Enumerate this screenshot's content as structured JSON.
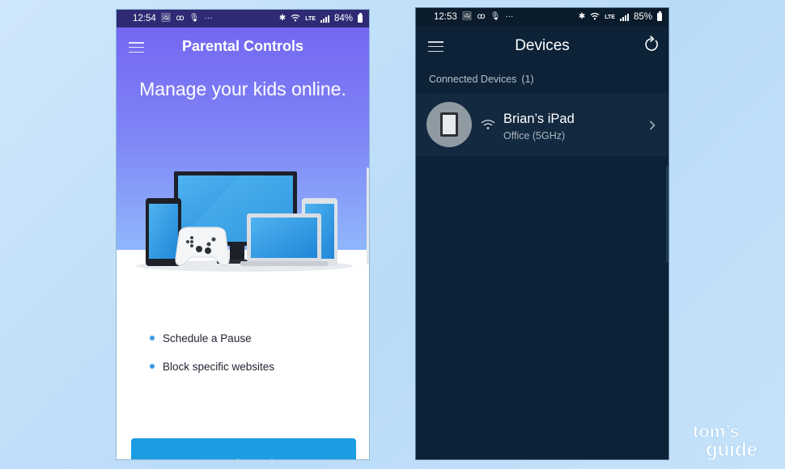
{
  "left_phone": {
    "status": {
      "time": "12:54",
      "icons": [
        "image-icon",
        "voicemail-icon",
        "mic-icon",
        "more-icon"
      ],
      "battery": "84%",
      "network": "LTE"
    },
    "header": {
      "title": "Parental Controls"
    },
    "headline": "Manage your kids online.",
    "features": [
      {
        "label": "Schedule a Pause"
      },
      {
        "label": "Block specific websites"
      }
    ],
    "cta_label": "Control a Device",
    "colors": {
      "hero_top": "#7467f2",
      "hero_bottom": "#8fb7fb",
      "cta": "#1a9de3"
    }
  },
  "right_phone": {
    "status": {
      "time": "12:53",
      "icons": [
        "image-icon",
        "voicemail-icon",
        "mic-icon",
        "more-icon"
      ],
      "battery": "85%",
      "network": "LTE"
    },
    "header": {
      "title": "Devices"
    },
    "section": {
      "label": "Connected Devices",
      "count": "(1)"
    },
    "devices": [
      {
        "name": "Brian’s iPad",
        "location": "Office (5GHz)",
        "icon": "tablet-icon"
      }
    ],
    "colors": {
      "background": "#0d2237",
      "row": "#13293f"
    }
  },
  "watermark": {
    "line1": "tom’s",
    "line2": "guide"
  }
}
